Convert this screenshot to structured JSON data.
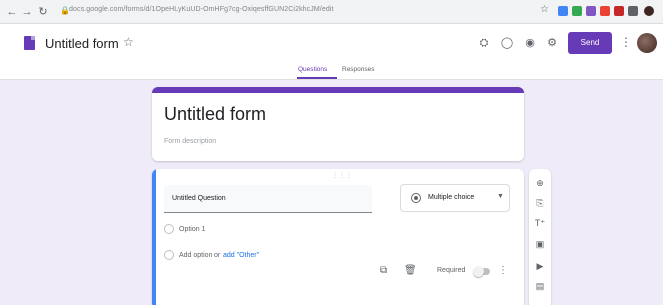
{
  "browser": {
    "back_icon": "arrow-left-icon",
    "forward_icon": "arrow-right-icon",
    "reload_icon": "reload-icon",
    "url": "docs.google.com/forms/d/1OpeHLyKuUD-OmHFg7cg-OxiqesffGUN2Ci2khcJM/edit",
    "extensions": [
      "#4285f4",
      "#34a853",
      "#7e57c2",
      "#ea4335",
      "#c62828",
      "#5f6368"
    ]
  },
  "header": {
    "title": "Untitled form",
    "send_label": "Send",
    "icons": [
      "puzzle-icon",
      "palette-icon",
      "eye-icon",
      "gear-icon"
    ],
    "tabs": [
      {
        "label": "Questions",
        "active": true
      },
      {
        "label": "Responses",
        "active": false
      }
    ],
    "accent": "#673ab7"
  },
  "form": {
    "title": "Untitled form",
    "description_placeholder": "Form description"
  },
  "question": {
    "text": "Untitled Question",
    "type": "Multiple choice",
    "options": [
      "Option 1"
    ],
    "add_option_label": "Add option",
    "or_label": "or",
    "add_other_label": "add \"Other\"",
    "required_label": "Required"
  },
  "toolbar": {
    "icons": [
      "add-circle-icon",
      "import-icon",
      "title-icon",
      "image-icon",
      "video-icon",
      "section-icon"
    ]
  }
}
